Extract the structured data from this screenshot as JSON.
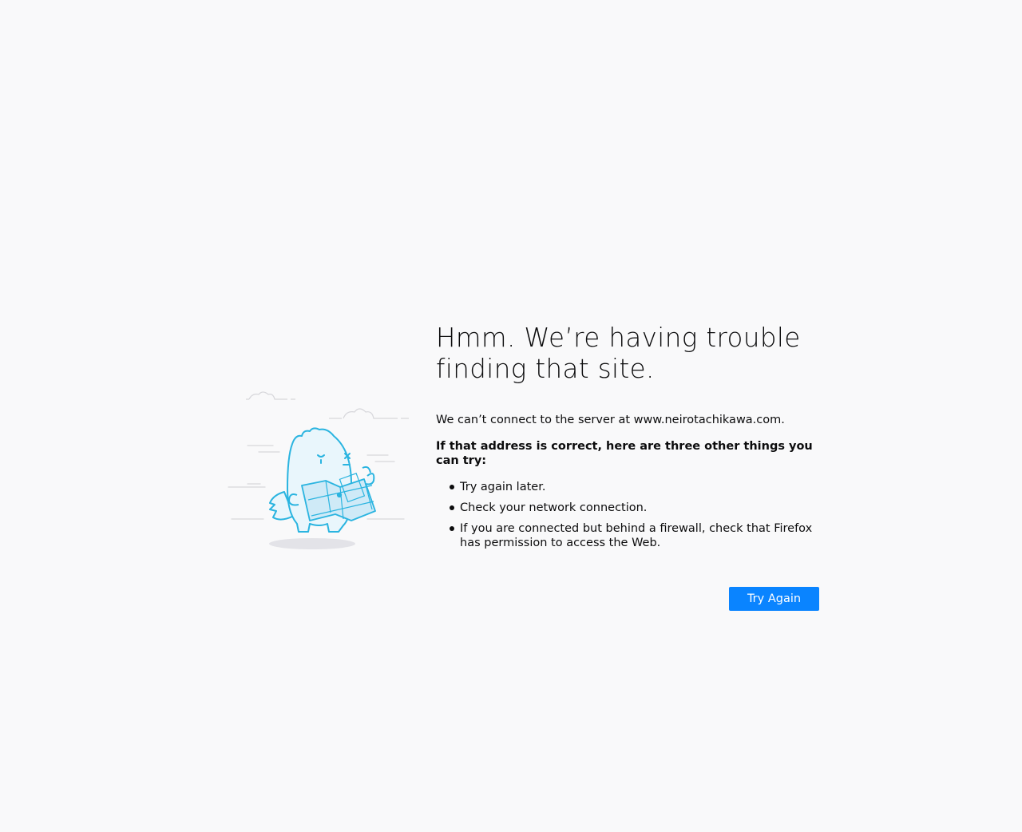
{
  "error_page": {
    "title": "Hmm. We’re having trouble finding that site.",
    "description": "We can’t connect to the server at www.neirotachikawa.com.",
    "suggestions_heading": "If that address is correct, here are three other things you can try:",
    "suggestions": [
      "Try again later.",
      "Check your network connection.",
      "If you are connected but behind a firewall, check that Firefox has permission to access the Web."
    ],
    "try_again_label": "Try Again",
    "illustration_icon": "confused-monster-with-map-icon"
  },
  "colors": {
    "background": "#f9f9fa",
    "accent": "#0a84ff",
    "illustration_stroke": "#2ab4e0",
    "illustration_fill": "#e9f6fc"
  }
}
